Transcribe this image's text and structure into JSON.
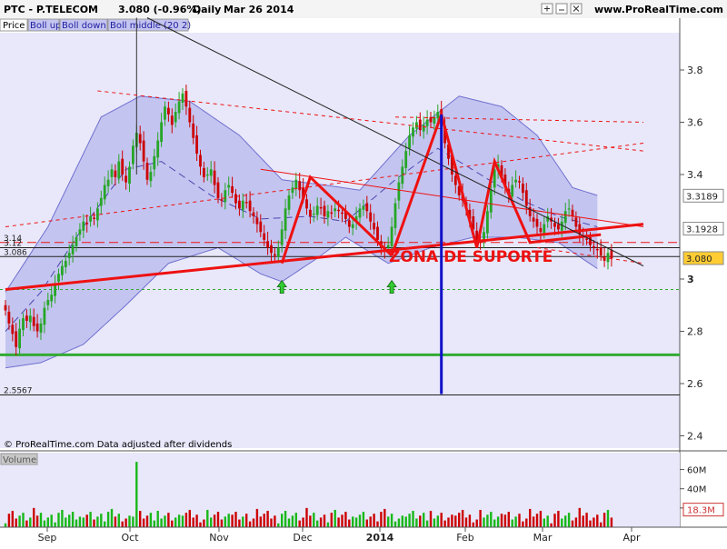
{
  "header": {
    "symbol": "PTC - P.TELECOM",
    "quote": "3.080 (-0.96%)",
    "period": "Daily",
    "date": "Mar 26 2014",
    "site": "www.ProRealTime.com",
    "window_buttons": [
      "zoom-icon",
      "minimize-icon",
      "close-icon"
    ]
  },
  "legend": [
    "Price",
    "Boll up",
    "Boll down",
    "Boll middle (20 2)"
  ],
  "footer_note": "© ProRealTime.com Data adjusted after dividends",
  "annotation": "ZONA DE SUPORTE",
  "colors": {
    "background": "#e8e8fa",
    "band_fill": "#c4c4f0",
    "up_candle": "#26a626",
    "down_candle": "#cc0000",
    "trend_red": "#ee1111",
    "support_green": "#33aa33",
    "blue_line": "#1010c8",
    "volume_bar": "#18b818"
  },
  "chart_data": {
    "type": "candlestick",
    "ylim": [
      2.4,
      3.9
    ],
    "y_ticks": [
      "3.8",
      "3.6",
      "3.4",
      "3",
      "2.8",
      "2.6",
      "2.4"
    ],
    "x_ticks": [
      "Sep",
      "Oct",
      "Nov",
      "Dec",
      "2014",
      "Feb",
      "Mar",
      "Apr"
    ],
    "axis_tags": [
      {
        "label": "3.3189",
        "value": 3.3189
      },
      {
        "label": "3.1928",
        "value": 3.1928
      },
      {
        "label": "3.080",
        "value": 3.08,
        "highlight": true
      }
    ],
    "left_labels": [
      {
        "label": "3.14",
        "value": 3.14
      },
      {
        "label": "3.12",
        "value": 3.12
      },
      {
        "label": "3.086",
        "value": 3.086
      },
      {
        "label": "2.5567",
        "value": 2.5567
      }
    ],
    "horizontal_levels": [
      {
        "value": 3.14,
        "style": "dashed-red"
      },
      {
        "value": 3.12,
        "style": "solid-black"
      },
      {
        "value": 3.086,
        "style": "solid-black"
      },
      {
        "value": 2.96,
        "style": "dotted-green"
      },
      {
        "value": 2.71,
        "style": "solid-green"
      },
      {
        "value": 2.5567,
        "style": "solid-black"
      }
    ],
    "closes": [
      2.88,
      2.83,
      2.79,
      2.74,
      2.81,
      2.85,
      2.84,
      2.86,
      2.82,
      2.8,
      2.83,
      2.89,
      2.92,
      2.94,
      2.98,
      3.02,
      3.05,
      3.07,
      3.1,
      3.13,
      3.16,
      3.19,
      3.22,
      3.21,
      3.24,
      3.23,
      3.27,
      3.31,
      3.36,
      3.38,
      3.42,
      3.39,
      3.45,
      3.4,
      3.37,
      3.43,
      3.51,
      3.56,
      3.52,
      3.45,
      3.38,
      3.41,
      3.47,
      3.53,
      3.6,
      3.66,
      3.63,
      3.59,
      3.64,
      3.68,
      3.71,
      3.66,
      3.6,
      3.54,
      3.48,
      3.43,
      3.39,
      3.4,
      3.42,
      3.36,
      3.31,
      3.3,
      3.34,
      3.36,
      3.33,
      3.29,
      3.27,
      3.3,
      3.29,
      3.26,
      3.24,
      3.21,
      3.18,
      3.15,
      3.12,
      3.1,
      3.09,
      3.12,
      3.19,
      3.27,
      3.32,
      3.35,
      3.38,
      3.34,
      3.31,
      3.27,
      3.24,
      3.25,
      3.28,
      3.27,
      3.24,
      3.26,
      3.25,
      3.27,
      3.26,
      3.25,
      3.23,
      3.2,
      3.21,
      3.24,
      3.27,
      3.28,
      3.26,
      3.22,
      3.19,
      3.15,
      3.12,
      3.11,
      3.13,
      3.2,
      3.29,
      3.37,
      3.43,
      3.49,
      3.55,
      3.58,
      3.6,
      3.57,
      3.59,
      3.61,
      3.6,
      3.62,
      3.64,
      3.59,
      3.52,
      3.46,
      3.4,
      3.36,
      3.32,
      3.3,
      3.27,
      3.23,
      3.19,
      3.15,
      3.14,
      3.18,
      3.26,
      3.34,
      3.42,
      3.44,
      3.39,
      3.35,
      3.32,
      3.36,
      3.38,
      3.37,
      3.33,
      3.28,
      3.24,
      3.22,
      3.2,
      3.18,
      3.21,
      3.24,
      3.22,
      3.2,
      3.19,
      3.22,
      3.26,
      3.27,
      3.24,
      3.2,
      3.17,
      3.16,
      3.15,
      3.13,
      3.12,
      3.11,
      3.09,
      3.07,
      3.1,
      3.08
    ],
    "bollinger": {
      "upper": [
        [
          2.95,
          0
        ],
        [
          3.2,
          12
        ],
        [
          3.62,
          27
        ],
        [
          3.7,
          38
        ],
        [
          3.68,
          52
        ],
        [
          3.55,
          66
        ],
        [
          3.38,
          78
        ],
        [
          3.36,
          90
        ],
        [
          3.34,
          100
        ],
        [
          3.55,
          114
        ],
        [
          3.7,
          128
        ],
        [
          3.66,
          140
        ],
        [
          3.55,
          150
        ],
        [
          3.35,
          160
        ],
        [
          3.32,
          167
        ]
      ],
      "lower": [
        [
          2.66,
          0
        ],
        [
          2.68,
          10
        ],
        [
          2.75,
          22
        ],
        [
          2.9,
          34
        ],
        [
          3.06,
          46
        ],
        [
          3.12,
          60
        ],
        [
          3.02,
          72
        ],
        [
          2.99,
          78
        ],
        [
          3.08,
          88
        ],
        [
          3.16,
          96
        ],
        [
          3.06,
          108
        ],
        [
          3.12,
          120
        ],
        [
          3.16,
          132
        ],
        [
          3.16,
          144
        ],
        [
          3.14,
          156
        ],
        [
          3.04,
          167
        ]
      ],
      "middle": [
        [
          2.8,
          0
        ],
        [
          2.95,
          10
        ],
        [
          3.2,
          22
        ],
        [
          3.42,
          34
        ],
        [
          3.45,
          44
        ],
        [
          3.32,
          58
        ],
        [
          3.23,
          72
        ],
        [
          3.24,
          86
        ],
        [
          3.22,
          96
        ],
        [
          3.38,
          110
        ],
        [
          3.5,
          122
        ],
        [
          3.4,
          134
        ],
        [
          3.3,
          146
        ],
        [
          3.24,
          156
        ],
        [
          3.2,
          167
        ]
      ]
    },
    "trendlines": [
      {
        "style": "red-thick",
        "points": [
          [
            0,
            2.96
          ],
          [
            180,
            3.21
          ]
        ]
      },
      {
        "style": "red-thick",
        "points": [
          [
            78,
            3.06
          ],
          [
            86,
            3.39
          ],
          [
            109,
            3.09
          ]
        ]
      },
      {
        "style": "red-thick",
        "points": [
          [
            109,
            3.09
          ],
          [
            123,
            3.63
          ],
          [
            133,
            3.12
          ],
          [
            138,
            3.45
          ],
          [
            148,
            3.14
          ],
          [
            168,
            3.17
          ]
        ]
      },
      {
        "style": "red-thin",
        "points": [
          [
            72,
            3.42
          ],
          [
            180,
            3.2
          ]
        ]
      },
      {
        "style": "red-dashed",
        "points": [
          [
            26,
            3.72
          ],
          [
            180,
            3.49
          ]
        ]
      },
      {
        "style": "red-dashed",
        "points": [
          [
            0,
            3.2
          ],
          [
            180,
            3.52
          ]
        ]
      },
      {
        "style": "red-dashed",
        "points": [
          [
            110,
            3.62
          ],
          [
            180,
            3.6
          ]
        ]
      },
      {
        "style": "red-dashed",
        "points": [
          [
            150,
            3.12
          ],
          [
            180,
            3.06
          ]
        ]
      },
      {
        "style": "black-thin",
        "points": [
          [
            40,
            4.0
          ],
          [
            180,
            3.05
          ]
        ]
      }
    ],
    "vertical_line": {
      "index": 123,
      "from": 2.56,
      "to": 3.63
    },
    "arrows": [
      78,
      109
    ],
    "volume": {
      "ticks": [
        "60M",
        "40M",
        "20M"
      ],
      "ymax": 70,
      "last_label": "18.3M",
      "spike": {
        "index": 37,
        "value": 68
      },
      "spike2": {
        "index": 180,
        "value": 14
      }
    }
  }
}
